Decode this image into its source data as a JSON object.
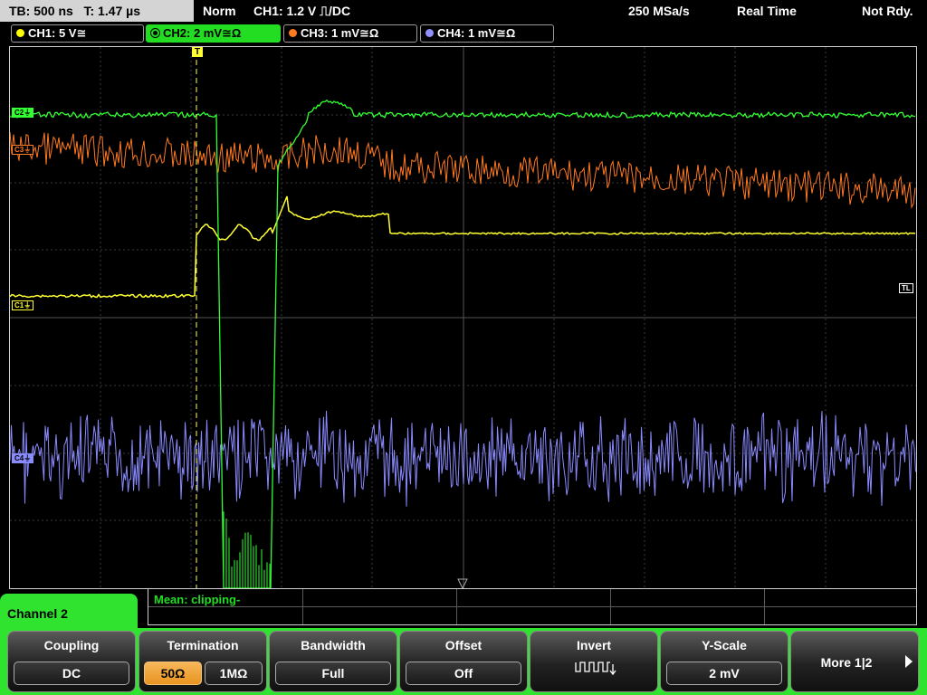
{
  "topbar": {
    "timebase": "TB: 500 ns",
    "trigger_time": "T: 1.47 µs",
    "mode": "Norm",
    "trigger_setting": "CH1: 1.2 V ⎍/DC",
    "sample_rate": "250 MSa/s",
    "acq_mode": "Real Time",
    "status": "Not Rdy."
  },
  "channels": [
    {
      "label": "CH1: 5 V≅",
      "color": "#ffff00"
    },
    {
      "label": "CH2: 2 mV≅Ω",
      "color": "#22dd22",
      "active": true
    },
    {
      "label": "CH3: 1 mV≅Ω",
      "color": "#ff7a1f"
    },
    {
      "label": "CH4: 1 mV≅Ω",
      "color": "#9090ff"
    }
  ],
  "plot": {
    "markers": {
      "c1": "C1⏚",
      "c3": "C3⏚",
      "c2": "C2⏚",
      "c4": "C4⏚",
      "tl": "TL",
      "trigger": "T"
    },
    "colors": {
      "ch1": "#ffff33",
      "ch2": "#33ff33",
      "ch3": "#ff7a22",
      "ch4": "#8a8aff",
      "grid": "#3a3a3a"
    }
  },
  "measurement": {
    "text": "Mean: clipping-"
  },
  "menu": {
    "title": "Channel 2",
    "coupling": {
      "title": "Coupling",
      "value": "DC"
    },
    "termination": {
      "title": "Termination",
      "option_50": "50Ω",
      "option_1m": "1MΩ"
    },
    "bandwidth": {
      "title": "Bandwidth",
      "value": "Full"
    },
    "offset": {
      "title": "Offset",
      "value": "Off"
    },
    "invert": {
      "title": "Invert"
    },
    "yscale": {
      "title": "Y-Scale",
      "value": "2 mV"
    },
    "more": {
      "label": "More 1|2"
    }
  }
}
